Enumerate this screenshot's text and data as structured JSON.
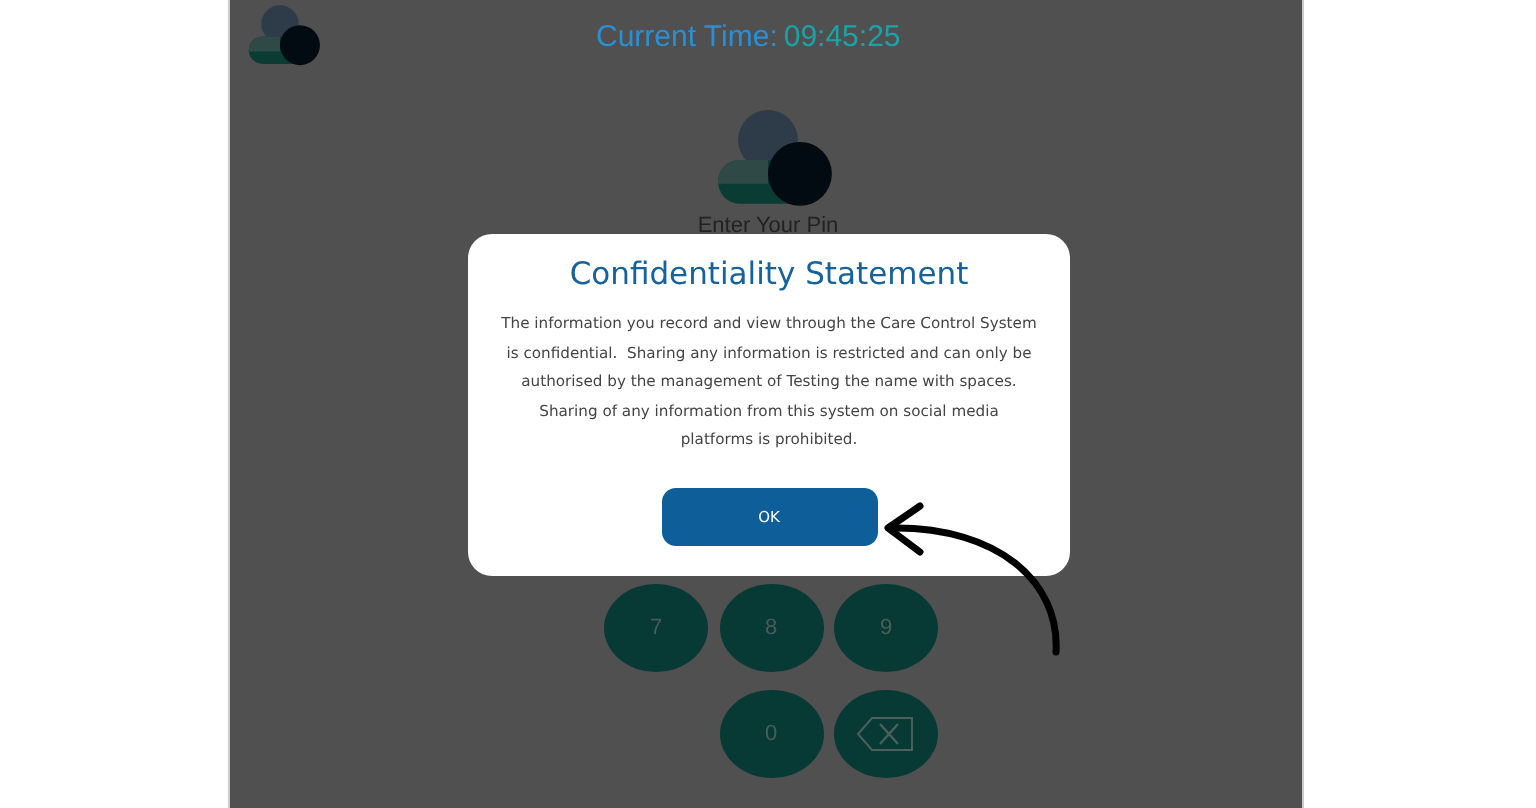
{
  "header": {
    "time_label": "Current Time:",
    "time_value": "09:45:25"
  },
  "heading": "Enter Your Pin",
  "keypad": [
    {
      "kind": "digit",
      "label": "7"
    },
    {
      "kind": "digit",
      "label": "8"
    },
    {
      "kind": "digit",
      "label": "9"
    },
    {
      "kind": "blank"
    },
    {
      "kind": "digit",
      "label": "0"
    },
    {
      "kind": "backspace"
    }
  ],
  "dialog": {
    "title": "Confidentiality Statement",
    "message": "The information you record and view through the Care Control System is confidential.  Sharing any information is restricted and can only be authorised by the management of Testing the name with spaces.  Sharing of any information from this system on social media platforms is prohibited.",
    "buttons": [
      "OK"
    ]
  }
}
